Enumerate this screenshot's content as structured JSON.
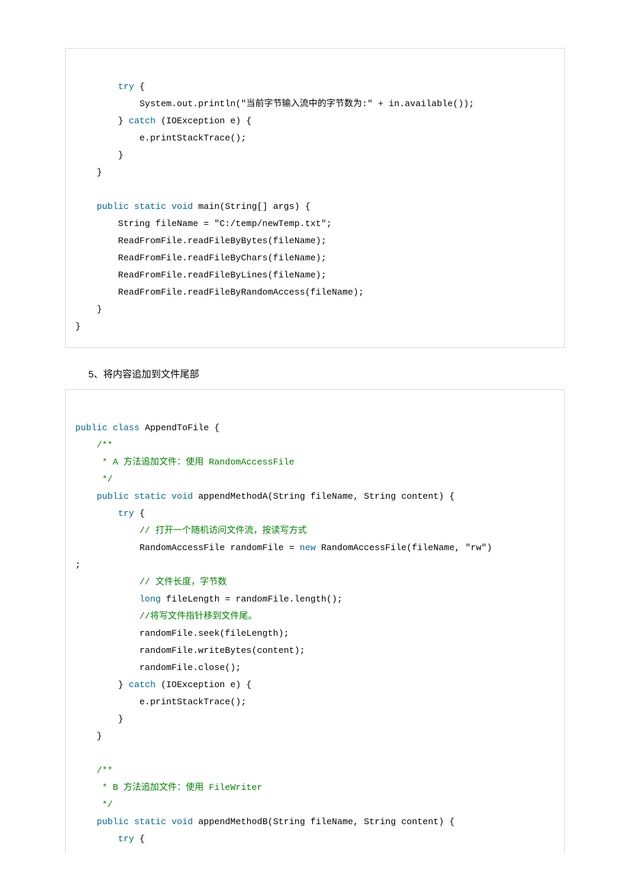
{
  "code1": {
    "l1a": "try",
    "l1b": " {",
    "l2": "            System.out.println(\"当前字节输入流中的字节数为:\" + in.available());",
    "l3a": "        } ",
    "l3b": "catch",
    "l3c": " (IOException e) {",
    "l4": "            e.printStackTrace();",
    "l5": "        }",
    "l6": "    }",
    "l7": " ",
    "l8a": "public",
    "l8b": "static",
    "l8c": "void",
    "l8d": " main(String[] args) {",
    "l9": "        String fileName = \"C:/temp/newTemp.txt\";",
    "l10": "        ReadFromFile.readFileByBytes(fileName);",
    "l11": "        ReadFromFile.readFileByChars(fileName);",
    "l12": "        ReadFromFile.readFileByLines(fileName);",
    "l13": "        ReadFromFile.readFileByRandomAccess(fileName);",
    "l14": "    }",
    "l15": "}"
  },
  "section_title": "5、将内容追加到文件尾部",
  "code2": {
    "l1a": "public",
    "l1b": "class",
    "l1c": " AppendToFile {",
    "l2": "    /**",
    "l3": "     * A 方法追加文件：使用 RandomAccessFile",
    "l4": "     */",
    "l5a": "public",
    "l5b": "static",
    "l5c": "void",
    "l5d": " appendMethodA(String fileName, String content) {",
    "l6a": "try",
    "l6b": " {",
    "l7": "            // 打开一个随机访问文件流，按读写方式",
    "l8a": "            RandomAccessFile randomFile = ",
    "l8b": "new",
    "l8c": " RandomAccessFile(fileName, \"rw\")",
    "l8d": ";",
    "l9": "            // 文件长度，字节数",
    "l10a": "long",
    "l10b": " fileLength = randomFile.length();",
    "l11": "            //将写文件指针移到文件尾。",
    "l12": "            randomFile.seek(fileLength);",
    "l13": "            randomFile.writeBytes(content);",
    "l14": "            randomFile.close();",
    "l15a": "        } ",
    "l15b": "catch",
    "l15c": " (IOException e) {",
    "l16": "            e.printStackTrace();",
    "l17": "        }",
    "l18": "    }",
    "l19": " ",
    "l20": "    /**",
    "l21": "     * B 方法追加文件：使用 FileWriter",
    "l22": "     */",
    "l23a": "public",
    "l23b": "static",
    "l23c": "void",
    "l23d": " appendMethodB(String fileName, String content) {",
    "l24a": "try",
    "l24b": " {"
  }
}
